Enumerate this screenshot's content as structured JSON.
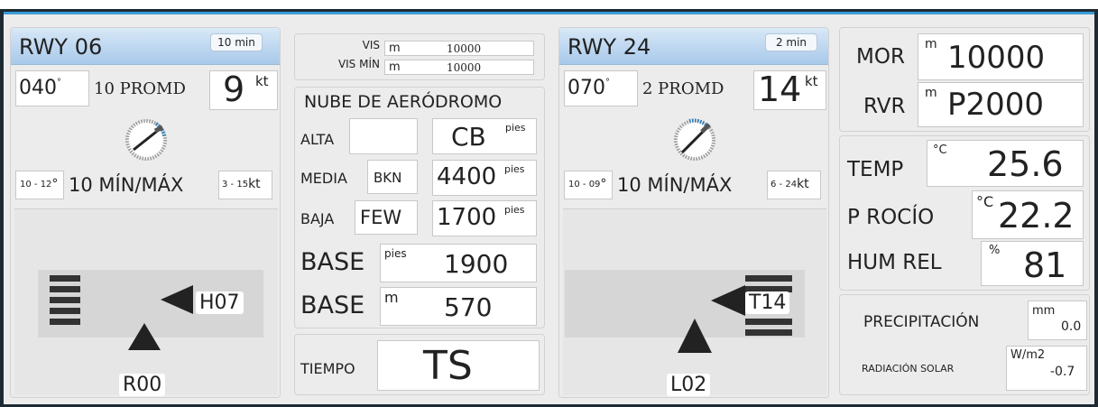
{
  "rwy06": {
    "title": "RWY 06",
    "period": "10 min",
    "dir": "040",
    "dir_unit": "°",
    "avg_label": "10 PROMD",
    "speed": "9",
    "speed_unit": "kt",
    "min_range": "10 - 12",
    "min_range_unit": "°",
    "minmax_label": "10 MÍN/MÁX",
    "max_range": "3 - 15",
    "max_range_unit": "kt",
    "tag_right": "H07",
    "tag_bottom": "R00"
  },
  "rwy24": {
    "title": "RWY 24",
    "period": "2 min",
    "dir": "070",
    "dir_unit": "°",
    "avg_label": "2 PROMD",
    "speed": "14",
    "speed_unit": "kt",
    "min_range": "10 - 09",
    "min_range_unit": "°",
    "minmax_label": "10 MÍN/MÁX",
    "max_range": "6 - 24",
    "max_range_unit": "kt",
    "tag_right": "T14",
    "tag_bottom": "L02"
  },
  "visibility": {
    "vis_label": "VIS",
    "vis_unit": "m",
    "vis_value": "10000",
    "vismin_label": "VIS MÍN",
    "vismin_unit": "m",
    "vismin_value": "10000"
  },
  "cloud": {
    "title": "NUBE DE AERÓDROMO",
    "alta_label": "ALTA",
    "alta_cover": "",
    "alta_value": "CB",
    "alta_unit": "pies",
    "media_label": "MEDIA",
    "media_cover": "BKN",
    "media_value": "4400",
    "media_unit": "pies",
    "baja_label": "BAJA",
    "baja_cover": "FEW",
    "baja_value": "1700",
    "baja_unit": "pies",
    "base1_label": "BASE",
    "base1_unit": "pies",
    "base1_value": "1900",
    "base2_label": "BASE",
    "base2_unit": "m",
    "base2_value": "570"
  },
  "weather": {
    "label": "TIEMPO",
    "value": "TS"
  },
  "right": {
    "mor_label": "MOR",
    "mor_unit": "m",
    "mor_value": "10000",
    "rvr_label": "RVR",
    "rvr_unit": "m",
    "rvr_value": "P2000",
    "temp_label": "TEMP",
    "temp_unit": "°C",
    "temp_value": "25.6",
    "dew_label": "P ROCÍO",
    "dew_unit": "°C",
    "dew_value": "22.2",
    "hum_label": "HUM REL",
    "hum_unit": "%",
    "hum_value": "81",
    "precip_label": "PRECIPITACIÓN",
    "precip_unit": "mm",
    "precip_value": "0.0",
    "rad_label": "RADIACIÓN SOLAR",
    "rad_unit": "W/m2",
    "rad_value": "-0.7"
  },
  "colors": {
    "header_gradient_top": "#d8e8f7",
    "header_gradient_bottom": "#a8c9ea",
    "frame": "#1d2a33",
    "accent": "#3a9bd6"
  }
}
